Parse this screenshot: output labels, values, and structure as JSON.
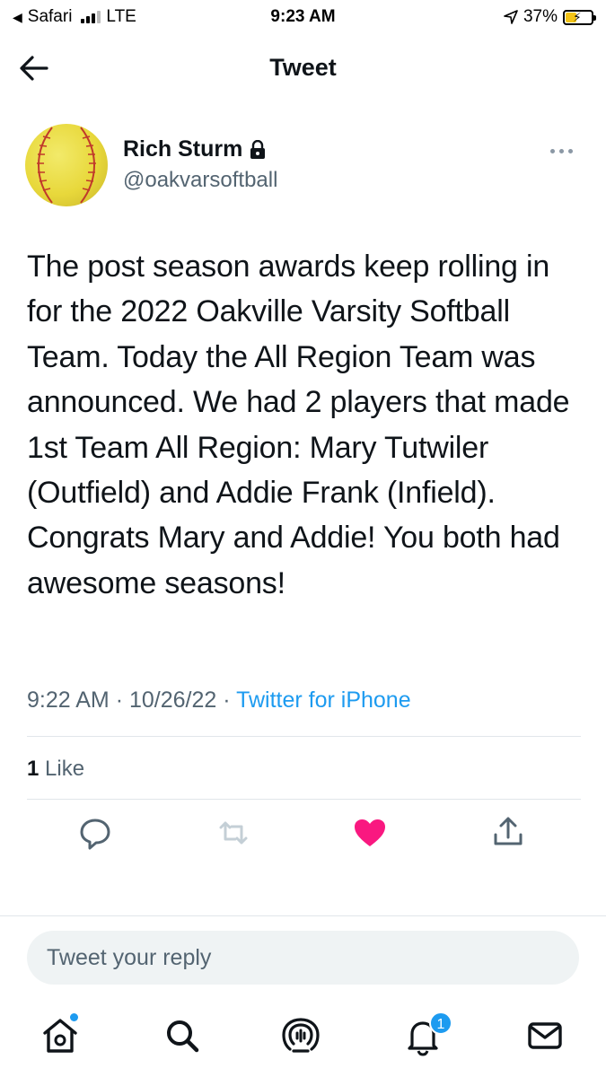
{
  "status_bar": {
    "back_app": "Safari",
    "network": "LTE",
    "time": "9:23 AM",
    "battery": "37%"
  },
  "header": {
    "title": "Tweet"
  },
  "author": {
    "name": "Rich Sturm",
    "handle": "@oakvarsoftball",
    "protected": true
  },
  "tweet": {
    "text": "The post season awards keep rolling in for the 2022 Oakville Varsity Softball Team. Today the All Region Team was announced. We had 2 players that made 1st Team All Region: Mary Tutwiler (Outfield) and Addie Frank (Infield). Congrats Mary and Addie! You both had awesome seasons!",
    "time": "9:22 AM",
    "date": "10/26/22",
    "separator": "·",
    "source": "Twitter for iPhone"
  },
  "stats": {
    "likes_count": "1",
    "likes_label": "Like"
  },
  "actions": {
    "reply_icon": "reply-icon",
    "retweet_icon": "retweet-icon",
    "like_icon": "heart-icon",
    "share_icon": "share-icon",
    "liked": true,
    "like_color": "#f91880"
  },
  "reply": {
    "placeholder": "Tweet your reply"
  },
  "tabbar": {
    "notifications_badge": "1",
    "accent": "#1d9bf0"
  }
}
